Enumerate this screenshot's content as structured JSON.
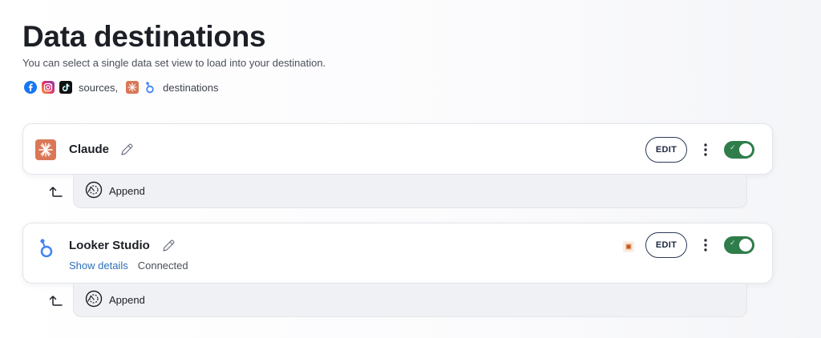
{
  "page": {
    "title": "Data destinations",
    "subtitle": "You can select a single data set view to load into your destination."
  },
  "legend": {
    "sources_label": "sources,",
    "destinations_label": "destinations",
    "source_icons": [
      "facebook-icon",
      "instagram-icon",
      "tiktok-icon"
    ],
    "destination_icons": [
      "claude-icon",
      "looker-studio-icon"
    ]
  },
  "destinations": [
    {
      "name": "Claude",
      "icon": "claude-icon",
      "edit_label": "EDIT",
      "enabled": true,
      "mode_label": "Append"
    },
    {
      "name": "Looker Studio",
      "icon": "looker-studio-icon",
      "edit_label": "EDIT",
      "enabled": true,
      "details_link": "Show details",
      "status": "Connected",
      "mode_label": "Append"
    }
  ],
  "colors": {
    "toggle_on": "#2f7d4b",
    "link": "#2e6fb8",
    "claude_brand": "#d97757",
    "looker_brand": "#4285f4"
  }
}
